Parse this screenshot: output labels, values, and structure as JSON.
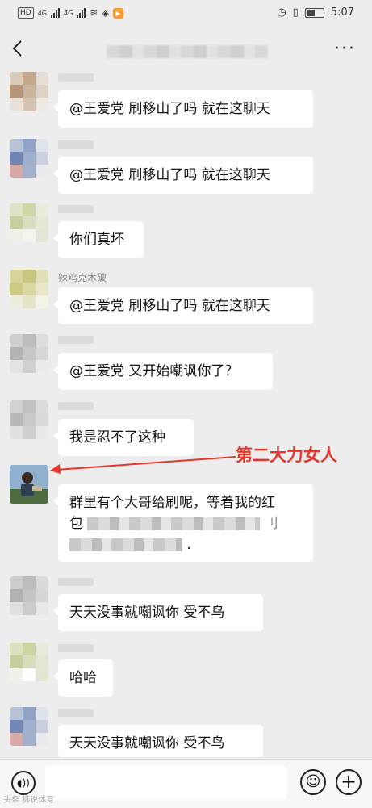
{
  "status_bar": {
    "hd": "HD",
    "net1": "4G",
    "net2": "4G",
    "app_badge": "▶",
    "time": "5:07"
  },
  "header": {
    "back_icon": "chevron-left-icon",
    "more_icon": "more-icon",
    "more_label": "···"
  },
  "messages": [
    {
      "nickname": "",
      "text": "@王爱党  刷移山了吗  就在这聊天"
    },
    {
      "nickname": "",
      "text": "@王爱党  刷移山了吗  就在这聊天"
    },
    {
      "nickname": "",
      "text": "你们真坏"
    },
    {
      "nickname": "辣鸡克木破",
      "text": "@王爱党  刷移山了吗  就在这聊天"
    },
    {
      "nickname": "",
      "text": "@王爱党  又开始嘲讽你了？"
    },
    {
      "nickname": "",
      "text": "我是忍不了这种"
    },
    {
      "nickname": "",
      "text_line1": "群里有个大哥给刷呢，等着我的红",
      "text_line2_prefix": "包",
      "text_line2_suffix": "刂",
      "text_line3_suffix": "."
    },
    {
      "nickname": "",
      "text": "天天没事就嘲讽你  受不鸟"
    },
    {
      "nickname": "",
      "text": "哈哈"
    },
    {
      "nickname": "",
      "text": "天天没事就嘲讽你  受不鸟"
    }
  ],
  "annotation": {
    "text": "第二大力女人",
    "color": "#e8352b"
  },
  "bottom_bar": {
    "voice_icon": "voice-icon",
    "emoji_icon": "emoji-icon",
    "plus_icon": "plus-icon"
  },
  "watermark": "头条 狮说体育"
}
